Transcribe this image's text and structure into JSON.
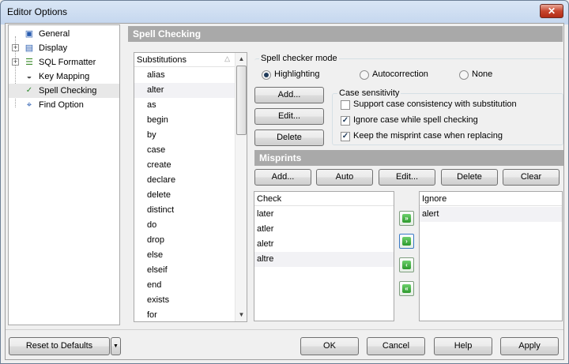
{
  "window": {
    "title": "Editor Options",
    "close_glyph": "✕"
  },
  "tree": {
    "items": [
      {
        "label": "General",
        "icon": "general-icon",
        "expandable": false
      },
      {
        "label": "Display",
        "icon": "display-icon",
        "expandable": true
      },
      {
        "label": "SQL Formatter",
        "icon": "sql-formatter-icon",
        "expandable": true
      },
      {
        "label": "Key Mapping",
        "icon": "key-mapping-icon",
        "expandable": false
      },
      {
        "label": "Spell Checking",
        "icon": "spell-checking-icon",
        "expandable": false,
        "selected": true
      },
      {
        "label": "Find Option",
        "icon": "find-option-icon",
        "expandable": false
      }
    ]
  },
  "section": {
    "title": "Spell Checking"
  },
  "substitutions": {
    "header": "Substitutions",
    "items": [
      "alias",
      "alter",
      "as",
      "begin",
      "by",
      "case",
      "create",
      "declare",
      "delete",
      "distinct",
      "do",
      "drop",
      "else",
      "elseif",
      "end",
      "exists",
      "for"
    ],
    "highlighted_index": 1
  },
  "mode": {
    "title": "Spell checker mode",
    "options": [
      {
        "label": "Highlighting",
        "selected": true
      },
      {
        "label": "Autocorrection",
        "selected": false
      },
      {
        "label": "None",
        "selected": false
      }
    ]
  },
  "sub_buttons": {
    "add": "Add...",
    "edit": "Edit...",
    "delete": "Delete"
  },
  "case_sensitivity": {
    "title": "Case sensitivity",
    "options": [
      {
        "label": "Support case consistency with substitution",
        "checked": false
      },
      {
        "label": "Ignore case while spell checking",
        "checked": true
      },
      {
        "label": "Keep the misprint case when replacing",
        "checked": true
      }
    ]
  },
  "misprints": {
    "title": "Misprints",
    "buttons": {
      "add": "Add...",
      "auto": "Auto",
      "edit": "Edit...",
      "delete": "Delete",
      "clear": "Clear"
    },
    "check_header": "Check",
    "check_items": [
      "later",
      "atler",
      "aletr",
      "altre"
    ],
    "ignore_header": "Ignore",
    "ignore_items": [
      "alert"
    ]
  },
  "footer": {
    "reset": "Reset to Defaults",
    "ok": "OK",
    "cancel": "Cancel",
    "help": "Help",
    "apply": "Apply"
  }
}
